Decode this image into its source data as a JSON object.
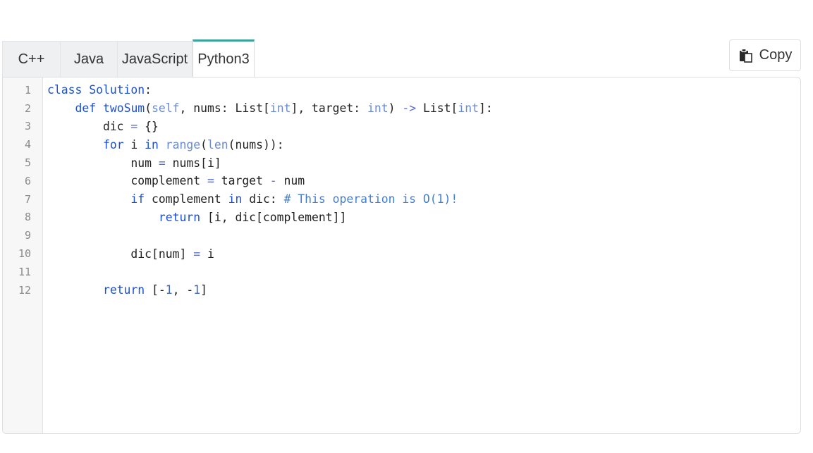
{
  "tabs": [
    {
      "label": "C++",
      "active": false
    },
    {
      "label": "Java",
      "active": false
    },
    {
      "label": "JavaScript",
      "active": false
    },
    {
      "label": "Python3",
      "active": true
    }
  ],
  "copy_button": {
    "label": "Copy",
    "icon": "copy-icon"
  },
  "colors": {
    "active_tab_accent": "#3aa39a",
    "keyword": "#1a4fd6",
    "builtin": "#6a8ad6",
    "comment": "#3f7fd2"
  },
  "code": {
    "language": "Python3",
    "lines": [
      [
        [
          "kw",
          "class"
        ],
        [
          "plain",
          " "
        ],
        [
          "kw",
          "Solution"
        ],
        [
          "plain",
          ":"
        ]
      ],
      [
        [
          "plain",
          "    "
        ],
        [
          "kw",
          "def"
        ],
        [
          "plain",
          " "
        ],
        [
          "kw",
          "twoSum"
        ],
        [
          "plain",
          "("
        ],
        [
          "builtin",
          "self"
        ],
        [
          "plain",
          ", nums: List["
        ],
        [
          "builtin",
          "int"
        ],
        [
          "plain",
          "], target: "
        ],
        [
          "builtin",
          "int"
        ],
        [
          "plain",
          ") "
        ],
        [
          "op",
          "->"
        ],
        [
          "plain",
          " List["
        ],
        [
          "builtin",
          "int"
        ],
        [
          "plain",
          "]:"
        ]
      ],
      [
        [
          "plain",
          "        dic "
        ],
        [
          "op",
          "="
        ],
        [
          "plain",
          " {}"
        ]
      ],
      [
        [
          "plain",
          "        "
        ],
        [
          "kw",
          "for"
        ],
        [
          "plain",
          " i "
        ],
        [
          "kw",
          "in"
        ],
        [
          "plain",
          " "
        ],
        [
          "builtin",
          "range"
        ],
        [
          "plain",
          "("
        ],
        [
          "builtin",
          "len"
        ],
        [
          "plain",
          "(nums)):"
        ]
      ],
      [
        [
          "plain",
          "            num "
        ],
        [
          "op",
          "="
        ],
        [
          "plain",
          " nums[i]"
        ]
      ],
      [
        [
          "plain",
          "            complement "
        ],
        [
          "op",
          "="
        ],
        [
          "plain",
          " target "
        ],
        [
          "op",
          "-"
        ],
        [
          "plain",
          " num"
        ]
      ],
      [
        [
          "plain",
          "            "
        ],
        [
          "kw",
          "if"
        ],
        [
          "plain",
          " complement "
        ],
        [
          "kw",
          "in"
        ],
        [
          "plain",
          " dic: "
        ],
        [
          "comment",
          "# This operation is O(1)!"
        ]
      ],
      [
        [
          "plain",
          "                "
        ],
        [
          "kw",
          "return"
        ],
        [
          "plain",
          " [i, dic[complement]]"
        ]
      ],
      [
        [
          "plain",
          ""
        ]
      ],
      [
        [
          "plain",
          "            dic[num] "
        ],
        [
          "op",
          "="
        ],
        [
          "plain",
          " i"
        ]
      ],
      [
        [
          "plain",
          ""
        ]
      ],
      [
        [
          "plain",
          "        "
        ],
        [
          "kw",
          "return"
        ],
        [
          "plain",
          " [-"
        ],
        [
          "num",
          "1"
        ],
        [
          "plain",
          ", -"
        ],
        [
          "num",
          "1"
        ],
        [
          "plain",
          "]"
        ]
      ]
    ]
  }
}
